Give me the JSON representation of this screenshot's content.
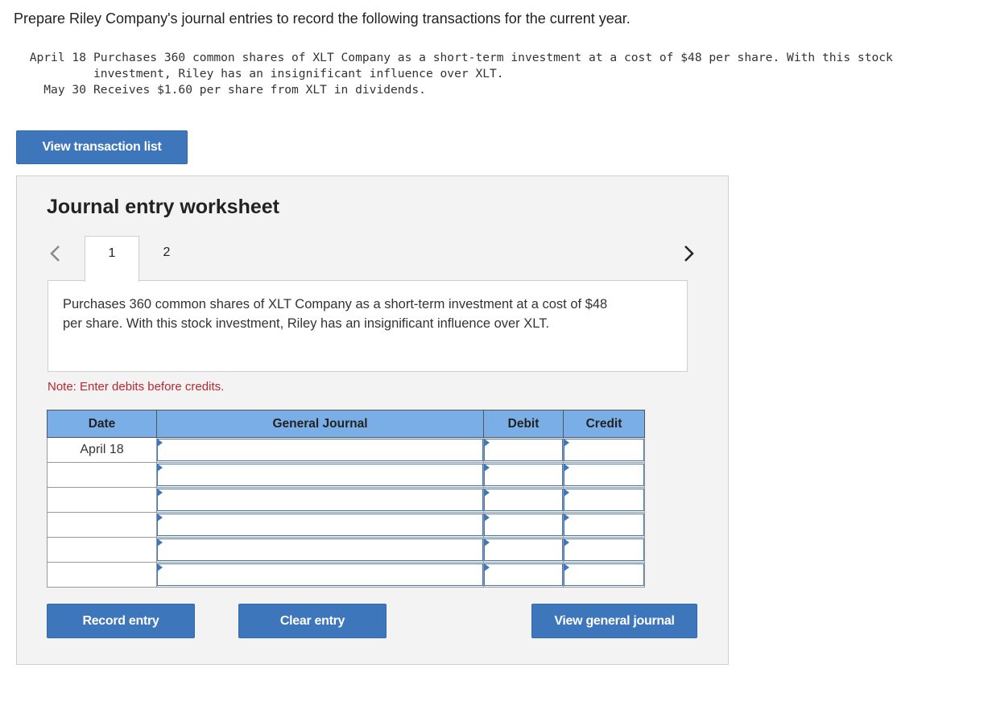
{
  "prompt": "Prepare Riley Company's journal entries to record the following transactions for the current year.",
  "transactions": [
    {
      "date": "April 18",
      "text": "Purchases 360 common shares of XLT Company as a short-term investment at a cost of $48 per share. With this stock investment, Riley has an insignificant influence over XLT."
    },
    {
      "date": "  May 30",
      "text": "Receives $1.60 per share from XLT in dividends."
    }
  ],
  "buttons": {
    "view_transaction_list": "View transaction list",
    "record_entry": "Record entry",
    "clear_entry": "Clear entry",
    "view_general_journal": "View general journal"
  },
  "worksheet": {
    "title": "Journal entry worksheet",
    "tabs": [
      "1",
      "2"
    ],
    "active_tab": "1",
    "description": "Purchases 360 common shares of XLT Company as a short-term investment at a cost of $48 per share. With this stock investment, Riley has an insignificant influence over XLT.",
    "note": "Note: Enter debits before credits.",
    "table": {
      "headers": {
        "date": "Date",
        "general_journal": "General Journal",
        "debit": "Debit",
        "credit": "Credit"
      },
      "rows": [
        {
          "date": "April 18",
          "account": "",
          "debit": "",
          "credit": ""
        },
        {
          "date": "",
          "account": "",
          "debit": "",
          "credit": ""
        },
        {
          "date": "",
          "account": "",
          "debit": "",
          "credit": ""
        },
        {
          "date": "",
          "account": "",
          "debit": "",
          "credit": ""
        },
        {
          "date": "",
          "account": "",
          "debit": "",
          "credit": ""
        },
        {
          "date": "",
          "account": "",
          "debit": "",
          "credit": ""
        }
      ]
    }
  },
  "icons": {
    "prev": "chevron-left-icon",
    "next": "chevron-right-icon"
  },
  "colors": {
    "primary_button": "#3d76bb",
    "table_header": "#7aaee6",
    "note": "#b7282e",
    "panel": "#f3f3f3"
  }
}
